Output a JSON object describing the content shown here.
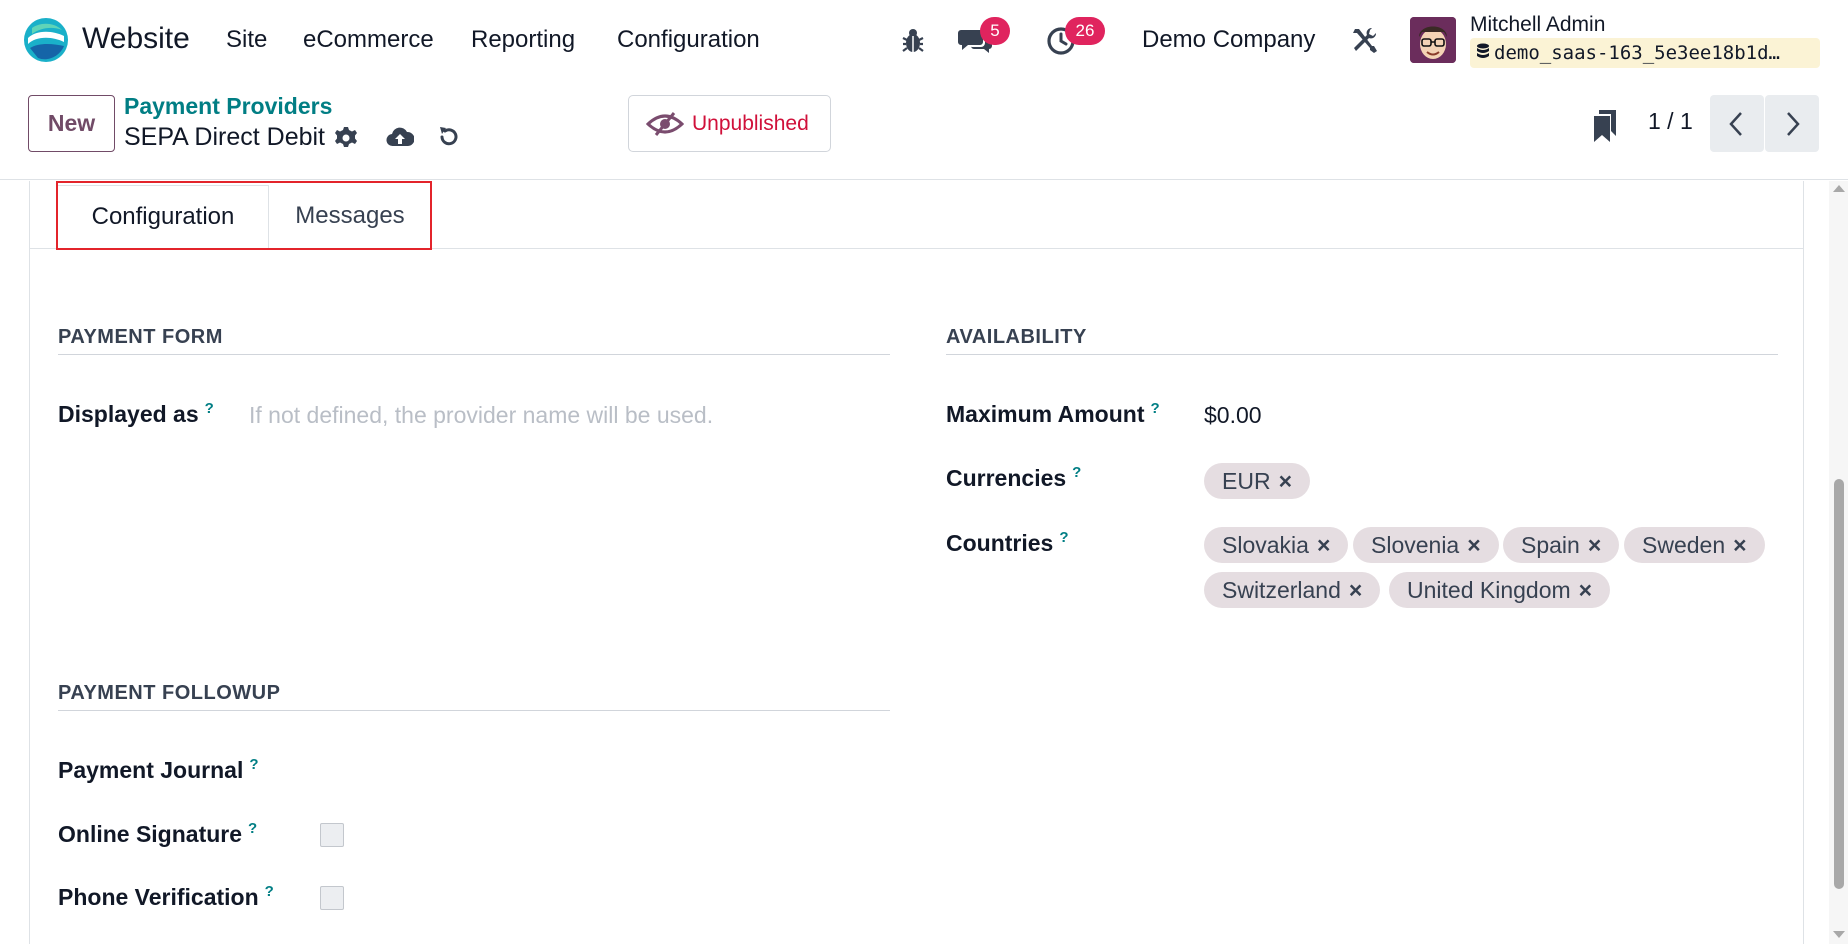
{
  "navbar": {
    "app_name": "Website",
    "menus": [
      "Site",
      "eCommerce",
      "Reporting",
      "Configuration"
    ],
    "messages_count": "5",
    "activities_count": "26",
    "company": "Demo Company",
    "user_name": "Mitchell Admin",
    "database": "demo_saas-163_5e3ee18b1d…"
  },
  "control": {
    "new_label": "New",
    "breadcrumb": "Payment Providers",
    "record_name": "SEPA Direct Debit",
    "publish_status": "Unpublished",
    "pager": "1 / 1"
  },
  "tabs": [
    {
      "label": "Configuration",
      "active": true
    },
    {
      "label": "Messages",
      "active": false
    }
  ],
  "payment_form": {
    "title": "PAYMENT FORM",
    "displayed_as_label": "Displayed as",
    "displayed_as_placeholder": "If not defined, the provider name will be used."
  },
  "availability": {
    "title": "AVAILABILITY",
    "max_amount_label": "Maximum Amount",
    "max_amount_value": "$0.00",
    "currencies_label": "Currencies",
    "currencies": [
      "EUR"
    ],
    "countries_label": "Countries",
    "countries": [
      "Slovakia",
      "Slovenia",
      "Spain",
      "Sweden",
      "Switzerland",
      "United Kingdom"
    ]
  },
  "payment_followup": {
    "title": "PAYMENT FOLLOWUP",
    "journal_label": "Payment Journal",
    "signature_label": "Online Signature",
    "signature_checked": false,
    "phone_label": "Phone Verification",
    "phone_checked": false
  },
  "help_mark": "?",
  "tag_remove": "×",
  "colors": {
    "brand": "#714b67",
    "accent": "#017e84",
    "danger": "#d0103a",
    "badge": "#e0245e",
    "tag_bg": "#e5dde1"
  }
}
